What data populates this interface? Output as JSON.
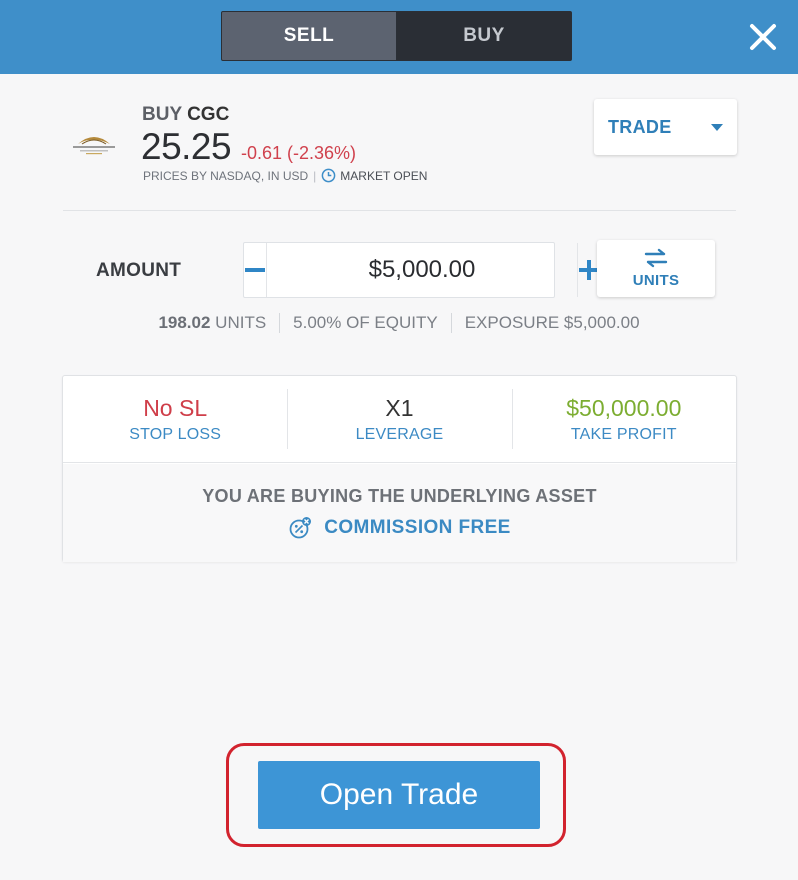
{
  "header": {
    "sell_label": "SELL",
    "buy_label": "BUY",
    "active": "sell"
  },
  "asset": {
    "action": "BUY",
    "ticker": "CGC",
    "price": "25.25",
    "change": "-0.61 (-2.36%)",
    "source": "PRICES BY NASDAQ, IN USD",
    "market_status": "MARKET OPEN",
    "logo_icon": "canopy-growth-logo"
  },
  "order_type": {
    "label": "TRADE"
  },
  "amount": {
    "label": "AMOUNT",
    "value": "$5,000.00",
    "toggle_label": "UNITS"
  },
  "meta": {
    "units_value": "198.02",
    "units_label": "UNITS",
    "equity": "5.00% OF EQUITY",
    "exposure": "EXPOSURE $5,000.00"
  },
  "settings": {
    "stop_loss_value": "No SL",
    "stop_loss_label": "STOP LOSS",
    "leverage_value": "X1",
    "leverage_label": "LEVERAGE",
    "take_profit_value": "$50,000.00",
    "take_profit_label": "TAKE PROFIT"
  },
  "info": {
    "buying_text": "YOU ARE BUYING THE UNDERLYING ASSET",
    "commission_text": "COMMISSION FREE"
  },
  "action": {
    "open_label": "Open Trade"
  },
  "colors": {
    "header": "#3f8fc9",
    "accent": "#2f7fb8",
    "negative": "#cf3e49",
    "positive": "#7cad31",
    "highlight": "#d2232e"
  }
}
